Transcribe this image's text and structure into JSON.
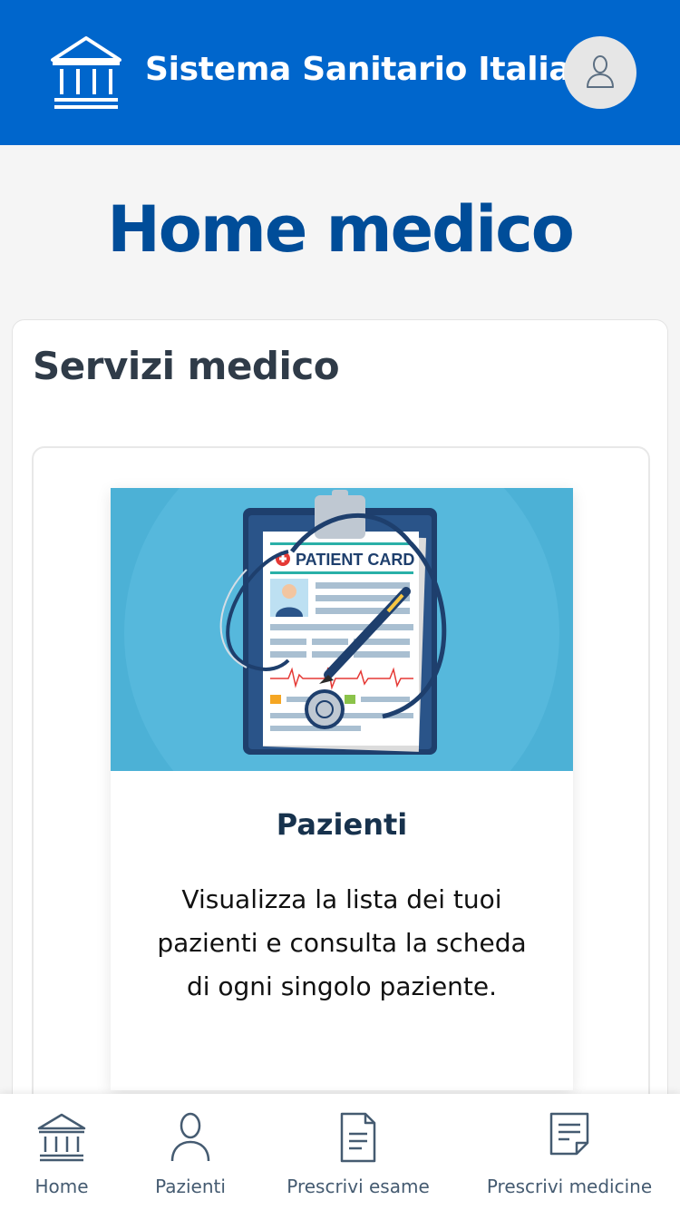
{
  "header": {
    "app_title": "Sistema Sanitario Italia",
    "logo_icon": "institution-icon",
    "profile_icon": "user-icon",
    "brand_color": "#0066cc"
  },
  "main": {
    "page_title": "Home medico",
    "section_title": "Servizi medico",
    "feature": {
      "image_text": "PATIENT CARD",
      "title": "Pazienti",
      "description": "Visualizza la lista dei tuoi pazienti e consulta la scheda di ogni singolo paziente."
    }
  },
  "bottom_nav": {
    "items": [
      {
        "label": "Home",
        "icon": "institution-icon"
      },
      {
        "label": "Pazienti",
        "icon": "user-icon"
      },
      {
        "label": "Prescrivi esame",
        "icon": "document-icon"
      },
      {
        "label": "Prescrivi medicine",
        "icon": "note-icon"
      }
    ]
  }
}
